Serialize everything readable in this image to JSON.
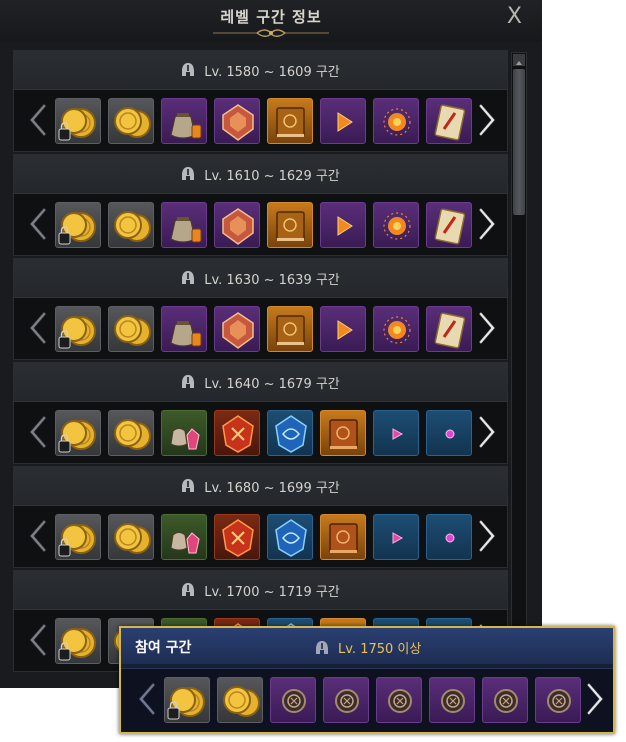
{
  "window": {
    "title": "레벨 구간 정보",
    "close_label": "X"
  },
  "sections": [
    {
      "label": "Lv. 1580 ~ 1609 구간",
      "items": [
        "locked-gold-coin",
        "gold-coins",
        "loot-bag",
        "red-gem",
        "orange-book",
        "fire-shard",
        "fire-crystal",
        "fire-card"
      ]
    },
    {
      "label": "Lv. 1610 ~ 1629 구간",
      "items": [
        "locked-gold-coin",
        "gold-coins",
        "loot-bag",
        "red-gem",
        "orange-book",
        "fire-shard",
        "fire-crystal",
        "fire-card"
      ]
    },
    {
      "label": "Lv. 1630 ~ 1639 구간",
      "items": [
        "locked-gold-coin",
        "gold-coins",
        "loot-bag",
        "red-gem",
        "orange-book",
        "fire-shard",
        "fire-crystal",
        "fire-card"
      ]
    },
    {
      "label": "Lv. 1640 ~ 1679 구간",
      "items": [
        "locked-gold-coin",
        "gold-coins",
        "pink-pouch",
        "red-rune-stone",
        "blue-rune-stone",
        "red-book",
        "pink-shard",
        "pink-orb"
      ]
    },
    {
      "label": "Lv. 1680 ~ 1699 구간",
      "items": [
        "locked-gold-coin",
        "gold-coins",
        "pink-pouch",
        "red-rune-stone",
        "blue-rune-stone",
        "red-book",
        "pink-shard",
        "pink-orb"
      ]
    },
    {
      "label": "Lv. 1700 ~ 1719 구간",
      "items": [
        "locked-gold-coin",
        "gold-coins",
        "pink-pouch",
        "red-rune-stone",
        "blue-rune-stone",
        "red-book",
        "pink-shard",
        "pink-orb"
      ]
    }
  ],
  "current": {
    "title": "참여 구간",
    "level_label": "Lv. 1750 이상",
    "items": [
      "locked-gold-coin",
      "gold-coins",
      "rune-medallion",
      "rune-medallion",
      "rune-medallion",
      "rune-medallion",
      "rune-medallion",
      "rune-medallion"
    ]
  },
  "colors": {
    "accent": "#d5b64a",
    "gold": "#f0c040",
    "panel": "#1a1b1e"
  }
}
